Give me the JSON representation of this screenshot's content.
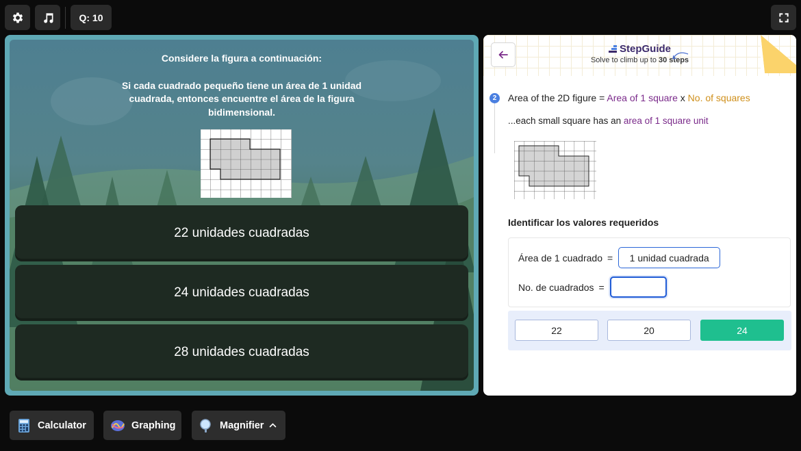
{
  "topbar": {
    "question_counter": "Q: 10"
  },
  "question": {
    "line1": "Considere la figura a continuación:",
    "line2": "Si cada cuadrado pequeño tiene un área de 1 unidad cuadrada, entonces encuentre el área de la figura bidimensional."
  },
  "options": [
    "22 unidades cuadradas",
    "24 unidades cuadradas",
    "28 unidades cuadradas"
  ],
  "guide": {
    "brand": "StepGuide",
    "subtitle_prefix": "Solve to climb up to ",
    "subtitle_bold": "30 steps",
    "step_number": "2",
    "formula": {
      "prefix": "Area of the 2D figure = ",
      "term1": "Area of 1 square",
      "op": " x ",
      "term2": "No. of squares"
    },
    "note": {
      "prefix": "...each small square has an ",
      "highlight": "area of 1 square unit"
    },
    "required_title": "Identificar los valores requeridos",
    "area_label": "Área de 1 cuadrado",
    "area_eq": "=",
    "area_value": "1 unidad cuadrada",
    "count_label": "No. de cuadrados",
    "count_eq": "=",
    "count_value": "",
    "choices": [
      "22",
      "20",
      "24"
    ]
  },
  "tools": {
    "calculator": "Calculator",
    "graphing": "Graphing",
    "magnifier": "Magnifier"
  },
  "colors": {
    "panel_border": "#5fa9b5",
    "option_bg": "#1e2a22",
    "accent_blue": "#2a66d8",
    "selected_green": "#1fbf8f",
    "purple": "#7a2a8a",
    "gold": "#cf8f1a"
  }
}
